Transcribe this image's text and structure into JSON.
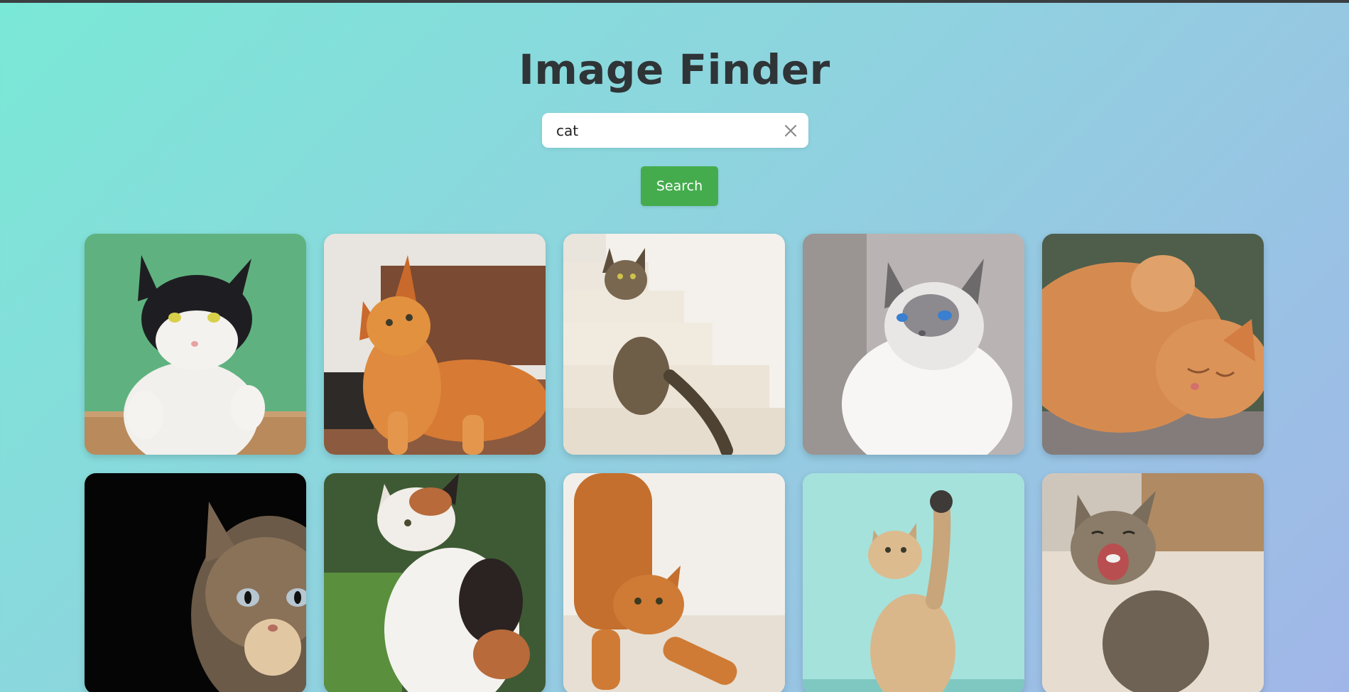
{
  "app": {
    "title": "Image Finder"
  },
  "search": {
    "value": "cat",
    "button_label": "Search",
    "clear_icon": "close-icon"
  },
  "colors": {
    "title": "#2f3437",
    "button": "#45ac4d",
    "gradient_start": "#7ae8d6",
    "gradient_end": "#a1b6e8"
  },
  "results": [
    {
      "subject": "black-and-white cat on green background"
    },
    {
      "subject": "orange long-haired cat lying down"
    },
    {
      "subject": "tabby cat sitting on stairs"
    },
    {
      "subject": "white cat with blue eyes"
    },
    {
      "subject": "orange cat sleeping on back"
    },
    {
      "subject": "tabby cat face in dark"
    },
    {
      "subject": "calico cat on grass"
    },
    {
      "subject": "orange cat stretching"
    },
    {
      "subject": "kitten raising paw"
    },
    {
      "subject": "tabby kitten yawning"
    }
  ]
}
